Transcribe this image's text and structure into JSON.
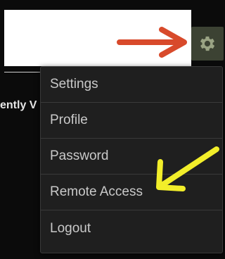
{
  "background_text": "ently V",
  "menu": {
    "items": [
      {
        "label": "Settings"
      },
      {
        "label": "Profile"
      },
      {
        "label": "Password"
      },
      {
        "label": "Remote Access"
      },
      {
        "label": "Logout"
      }
    ]
  },
  "icons": {
    "settings": "gear-icon"
  },
  "annotations": {
    "red_arrow_color": "#d84a2b",
    "yellow_arrow_color": "#f2ee2a"
  }
}
